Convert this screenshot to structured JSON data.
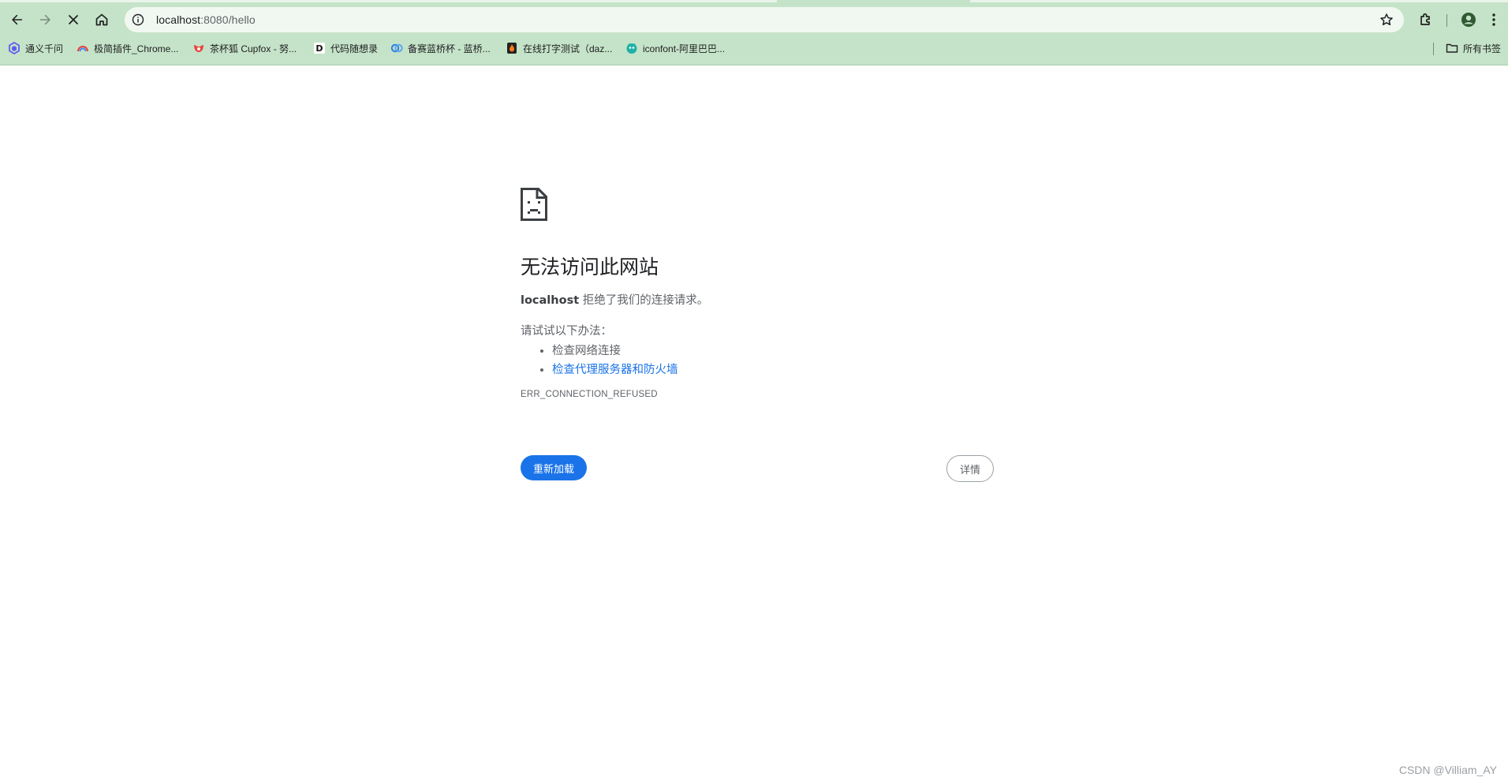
{
  "browser": {
    "url_host": "localhost",
    "url_rest": ":8080/hello",
    "bookmarks": [
      {
        "label": "通义千问",
        "icon": "tongyi-icon"
      },
      {
        "label": "极简插件_Chrome...",
        "icon": "rainbow-icon"
      },
      {
        "label": "茶杯狐 Cupfox - 努...",
        "icon": "cupfox-icon"
      },
      {
        "label": "代码随想录",
        "icon": "d-letter-icon"
      },
      {
        "label": "备赛蓝桥杯 - 蓝桥...",
        "icon": "lanqiao-icon"
      },
      {
        "label": "在线打字测试（daz...",
        "icon": "flame-icon"
      },
      {
        "label": "iconfont-阿里巴巴...",
        "icon": "iconfont-icon"
      }
    ],
    "all_bookmarks_label": "所有书签"
  },
  "error_page": {
    "title": "无法访问此网站",
    "summary_host": "localhost",
    "summary_text": " 拒绝了我们的连接请求。",
    "suggestions_heading": "请试试以下办法：",
    "suggestions": [
      {
        "text": "检查网络连接",
        "link": false
      },
      {
        "text": "检查代理服务器和防火墙",
        "link": true
      }
    ],
    "error_code": "ERR_CONNECTION_REFUSED",
    "reload_label": "重新加载",
    "details_label": "详情"
  },
  "watermark": "CSDN @Villiam_AY",
  "colors": {
    "chrome_bg": "#c5e3c8",
    "primary_button": "#1a73e8",
    "link": "#1a73e8"
  }
}
